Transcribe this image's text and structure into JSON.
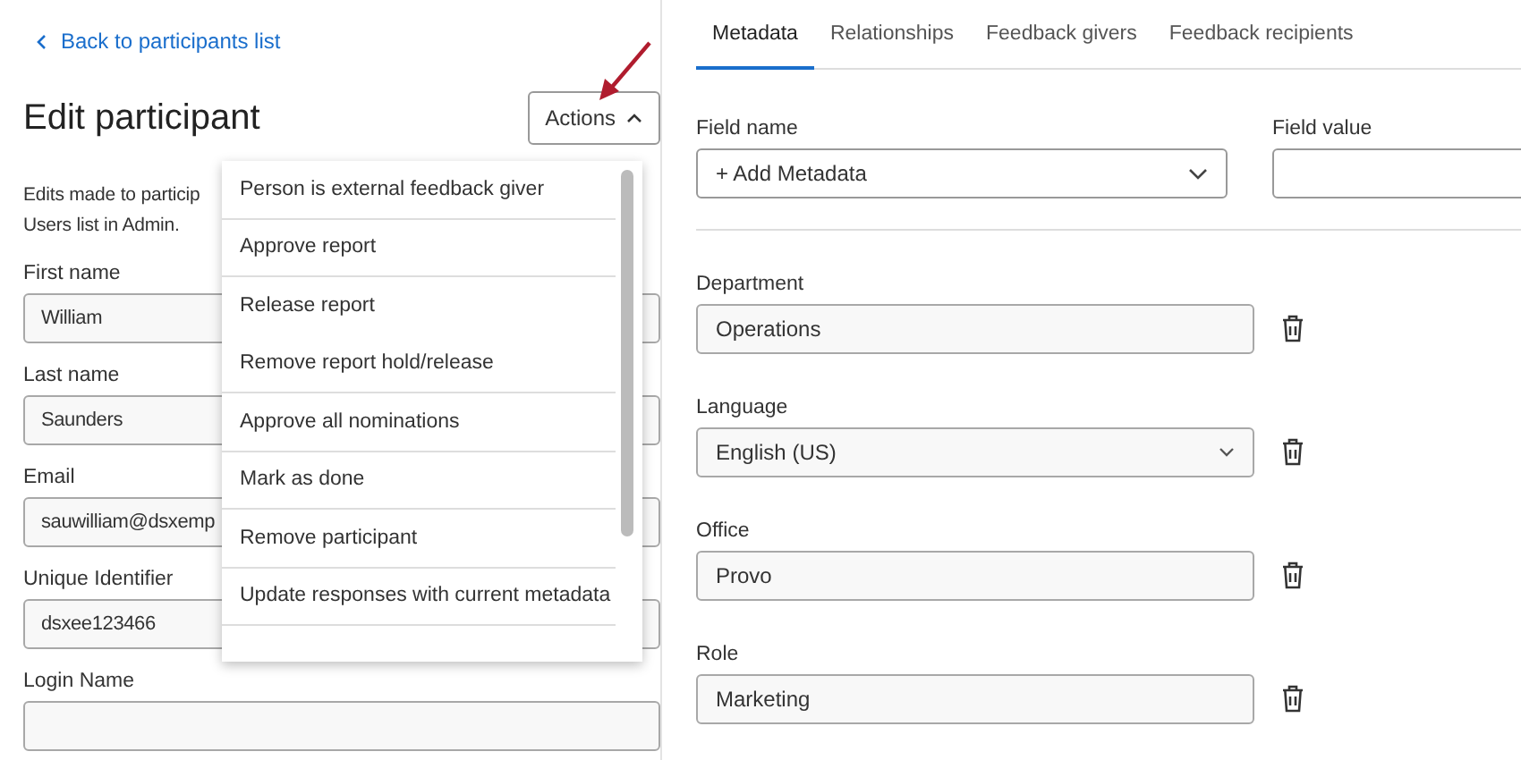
{
  "back_link": "Back to participants list",
  "title": "Edit participant",
  "actions_button": {
    "label": "Actions",
    "expanded": true
  },
  "description": [
    "Edits made to particip",
    "Users list in Admin."
  ],
  "fields": [
    {
      "label": "First name",
      "value": "William"
    },
    {
      "label": "Last name",
      "value": "Saunders"
    },
    {
      "label": "Email",
      "value": "sauwilliam@dsxemp"
    },
    {
      "label": "Unique Identifier",
      "value": "dsxee123466"
    },
    {
      "label": "Login Name"
    }
  ],
  "actions_menu": [
    {
      "label": "Person is external feedback giver",
      "divider_after": true
    },
    {
      "label": "Approve report",
      "divider_after": true
    },
    {
      "label": "Release report",
      "divider_after": false
    },
    {
      "label": "Remove report hold/release",
      "divider_after": true
    },
    {
      "label": "Approve all nominations",
      "divider_after": true
    },
    {
      "label": "Mark as done",
      "divider_after": true
    },
    {
      "label": "Remove participant",
      "divider_after": true
    },
    {
      "label": "Update responses with current metadata",
      "divider_after": true
    }
  ],
  "tabs": [
    {
      "label": "Metadata",
      "selected": true
    },
    {
      "label": "Relationships",
      "selected": false
    },
    {
      "label": "Feedback givers",
      "selected": false
    },
    {
      "label": "Feedback recipients",
      "selected": false
    }
  ],
  "new_metadata": {
    "field_name_label": "Field name",
    "field_name_value": "+ Add Metadata",
    "field_value_label": "Field value"
  },
  "metadata": [
    {
      "label": "Department",
      "value": "Operations",
      "kind": "text"
    },
    {
      "label": "Language",
      "value": "English (US)",
      "kind": "select"
    },
    {
      "label": "Office",
      "value": "Provo",
      "kind": "text"
    },
    {
      "label": "Role",
      "value": "Marketing",
      "kind": "text"
    }
  ]
}
